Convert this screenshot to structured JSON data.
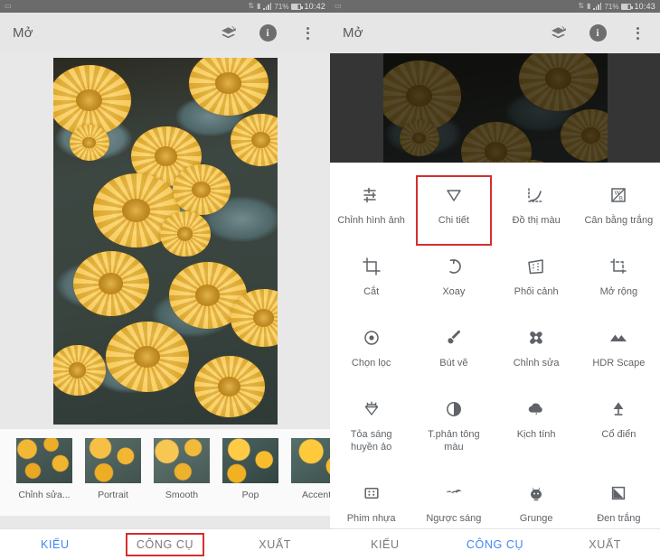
{
  "status_bar": {
    "left_icons": [
      "sim-icon"
    ],
    "right_icons": [
      "bluetooth-icon",
      "vibrate-icon",
      "signal-icon"
    ],
    "battery_percent": "71%",
    "time_left": "10:42",
    "time_right": "10:43"
  },
  "app_bar": {
    "title": "Mở",
    "actions": [
      {
        "name": "stack-revert-icon",
        "label": "Hoàn tác"
      },
      {
        "name": "info-icon",
        "label": "Thông tin"
      },
      {
        "name": "overflow-menu-icon",
        "label": "Tùy chọn"
      }
    ]
  },
  "left_panel": {
    "filmstrip": [
      {
        "label": "Chỉnh sửa...",
        "name": "look-original"
      },
      {
        "label": "Portrait",
        "name": "look-portrait"
      },
      {
        "label": "Smooth",
        "name": "look-smooth"
      },
      {
        "label": "Pop",
        "name": "look-pop"
      },
      {
        "label": "Accentu",
        "name": "look-accentuate"
      }
    ],
    "tabs": [
      {
        "label": "KIỂU",
        "active": true,
        "boxed": false
      },
      {
        "label": "CÔNG CỤ",
        "active": false,
        "boxed": true
      },
      {
        "label": "XUẤT",
        "active": false,
        "boxed": false
      }
    ]
  },
  "right_panel": {
    "tools": [
      {
        "label": "Chỉnh hình ảnh",
        "icon": "sliders-icon",
        "highlight": false
      },
      {
        "label": "Chi tiết",
        "icon": "triangle-detail-icon",
        "highlight": true
      },
      {
        "label": "Đồ thị màu",
        "icon": "curves-icon",
        "highlight": false
      },
      {
        "label": "Cân bằng trắng",
        "icon": "white-balance-icon",
        "highlight": false
      },
      {
        "label": "Cắt",
        "icon": "crop-icon",
        "highlight": false
      },
      {
        "label": "Xoay",
        "icon": "rotate-icon",
        "highlight": false
      },
      {
        "label": "Phối cảnh",
        "icon": "perspective-icon",
        "highlight": false
      },
      {
        "label": "Mở rộng",
        "icon": "expand-icon",
        "highlight": false
      },
      {
        "label": "Chọn lọc",
        "icon": "selective-icon",
        "highlight": false
      },
      {
        "label": "Bút vẽ",
        "icon": "brush-icon",
        "highlight": false
      },
      {
        "label": "Chỉnh sửa",
        "icon": "healing-icon",
        "highlight": false
      },
      {
        "label": "HDR Scape",
        "icon": "mountains-icon",
        "highlight": false
      },
      {
        "label": "Tỏa sáng huyền ảo",
        "icon": "glamour-glow-icon",
        "highlight": false
      },
      {
        "label": "T.phản tông màu",
        "icon": "tonal-contrast-icon",
        "highlight": false
      },
      {
        "label": "Kịch tính",
        "icon": "drama-cloud-icon",
        "highlight": false
      },
      {
        "label": "Cổ điển",
        "icon": "vintage-lamp-icon",
        "highlight": false
      },
      {
        "label": "Phim nhựa",
        "icon": "grainy-film-icon",
        "highlight": false
      },
      {
        "label": "Ngược sáng",
        "icon": "retrolux-icon",
        "highlight": false
      },
      {
        "label": "Grunge",
        "icon": "grunge-icon",
        "highlight": false
      },
      {
        "label": "Đen trắng",
        "icon": "black-white-icon",
        "highlight": false
      }
    ],
    "tabs": [
      {
        "label": "KIỂU",
        "active": false,
        "boxed": false
      },
      {
        "label": "CÔNG CỤ",
        "active": true,
        "boxed": false
      },
      {
        "label": "XUẤT",
        "active": false,
        "boxed": false
      }
    ]
  },
  "colors": {
    "accent": "#4285f4",
    "highlight_box": "#d32f2f",
    "appbar_bg": "#e6e6e6",
    "icon_gray": "#5f6368"
  }
}
